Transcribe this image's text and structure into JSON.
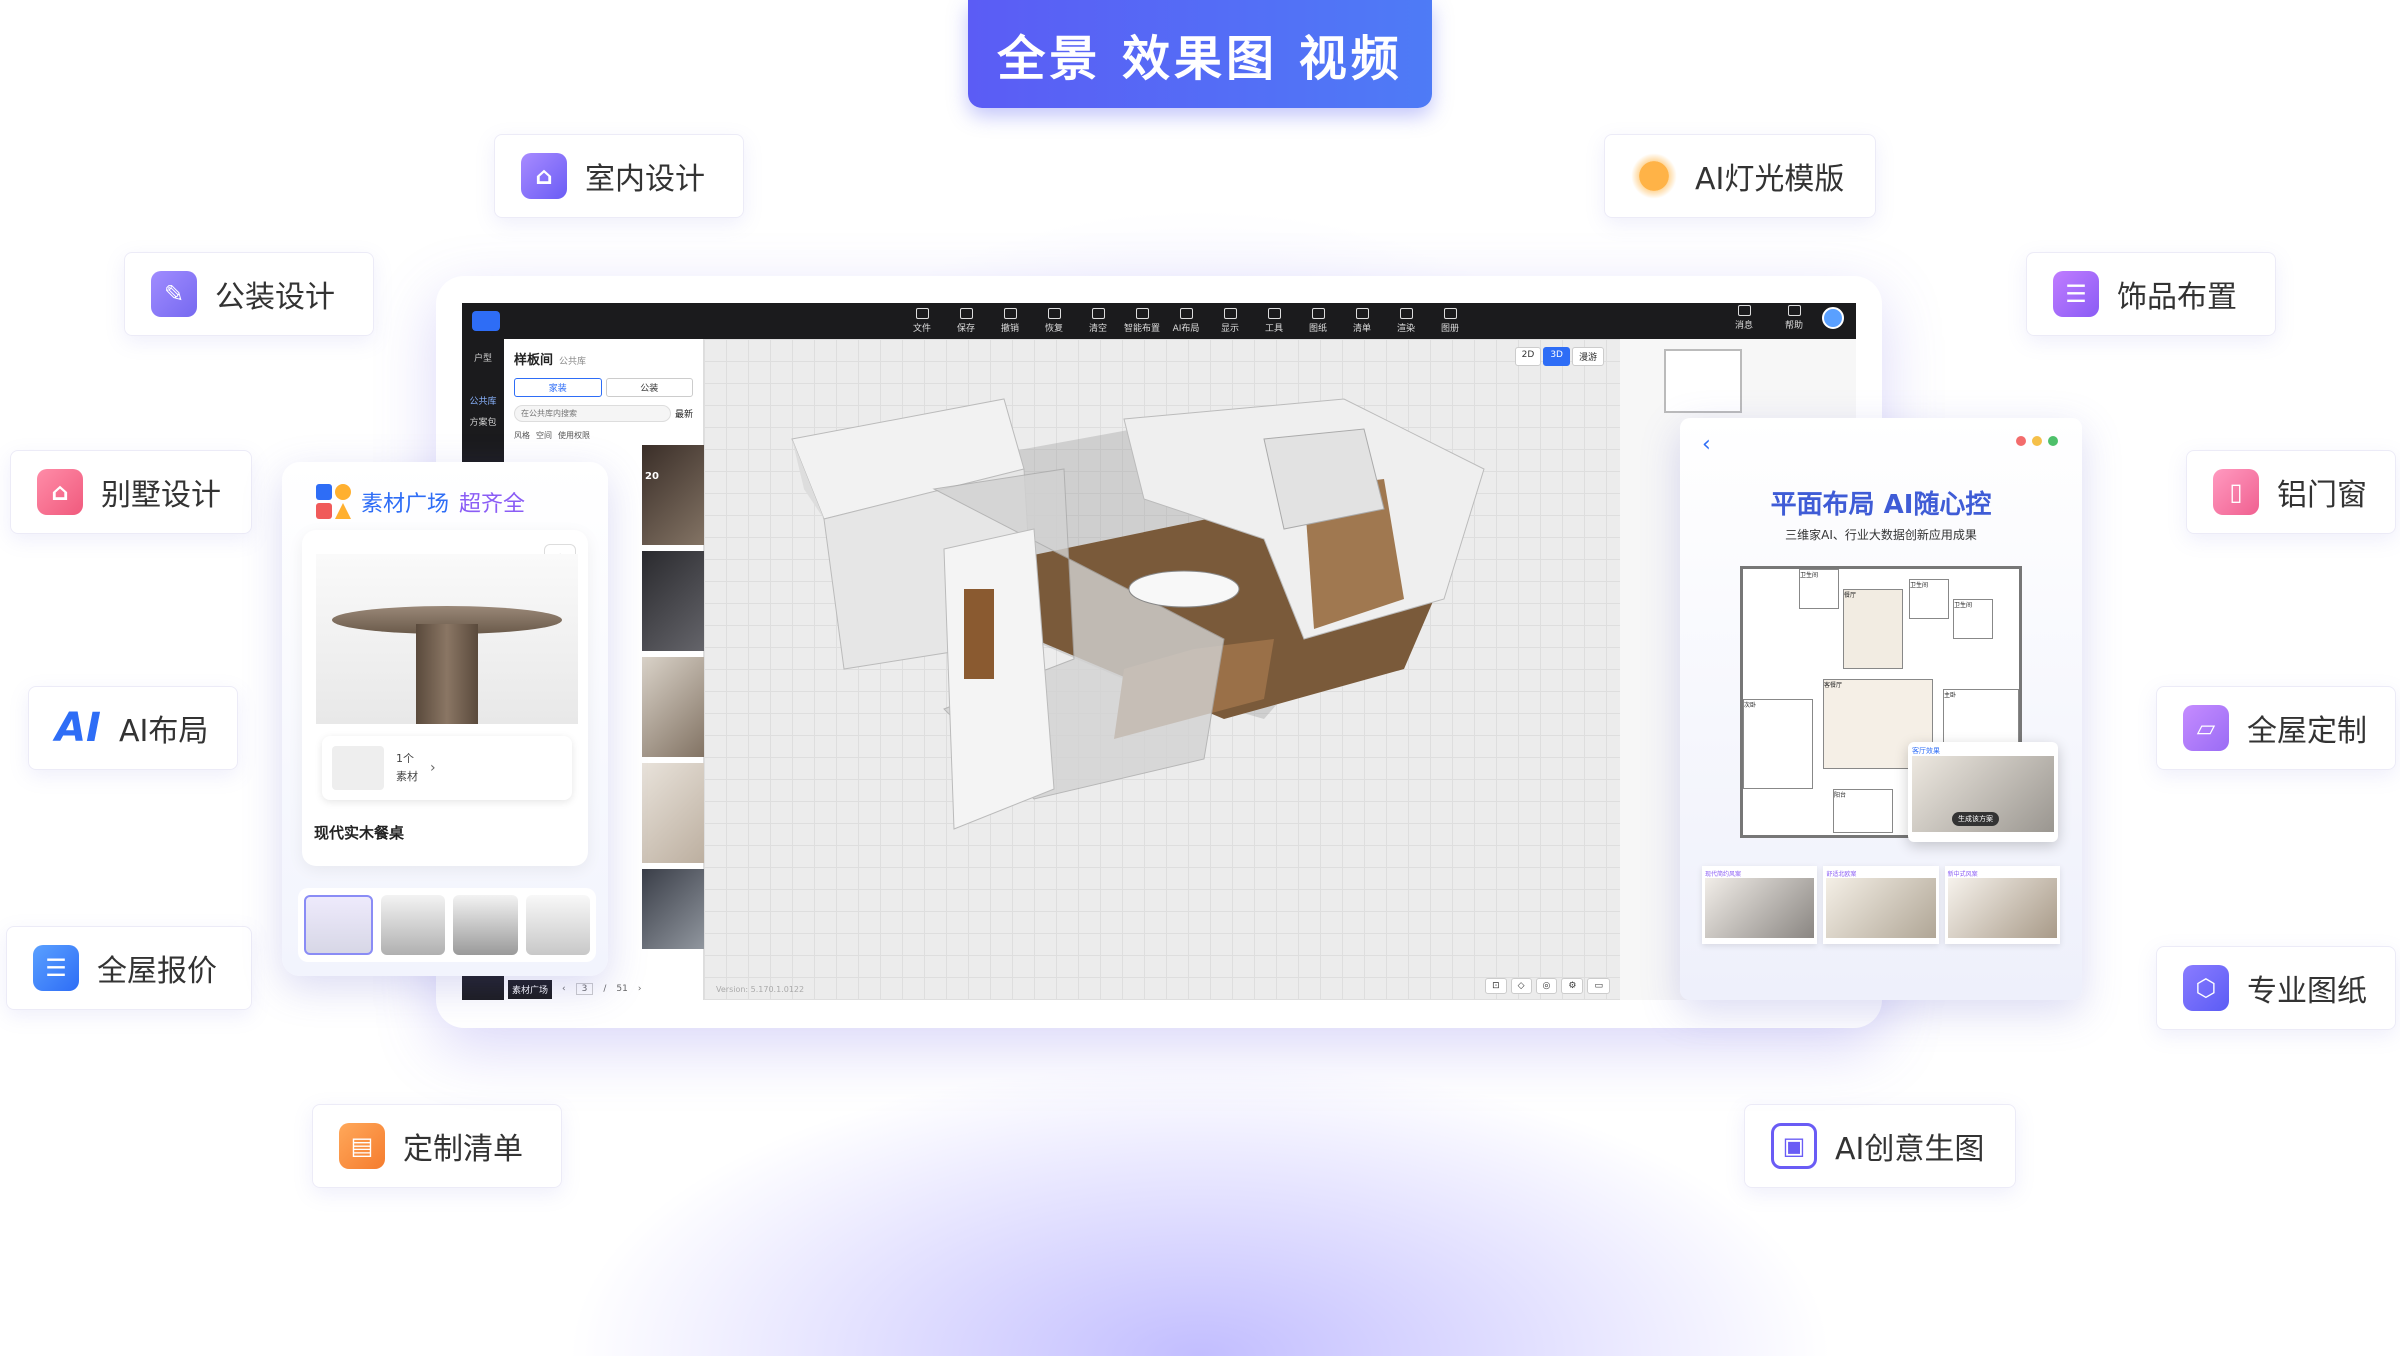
{
  "banner": {
    "title": "全景 效果图 视频"
  },
  "tags": {
    "interior": "室内设计",
    "lighting": "AI灯光模版",
    "public": "公装设计",
    "decor": "饰品布置",
    "villa": "别墅设计",
    "door": "铝门窗",
    "ai_layout": "AI布局",
    "custom": "全屋定制",
    "quote": "全屋报价",
    "drawing": "专业图纸",
    "list": "定制清单",
    "ai_image": "AI创意生图"
  },
  "toolbar": {
    "items": [
      "文件",
      "保存",
      "撤销",
      "恢复",
      "清空",
      "智能布置",
      "AI布局",
      "显示",
      "工具",
      "图纸",
      "清单",
      "渲染",
      "图册"
    ],
    "right": [
      "消息",
      "帮助"
    ]
  },
  "left_nav": [
    "户型",
    "公共库",
    "方案包"
  ],
  "panel": {
    "title": "样板间",
    "subtitle": "公共库",
    "tabs": [
      "家装",
      "公装"
    ],
    "search_placeholder": "在公共库内搜索",
    "sort": "最新",
    "filters": [
      "风格",
      "空间",
      "使用权限"
    ],
    "badge": "20",
    "page_current": "3",
    "page_total": "51",
    "bottom_tab": "素材广场"
  },
  "viewport": {
    "modes": [
      "2D",
      "3D",
      "漫游"
    ],
    "active_mode": "3D",
    "version": "Version: 5.170.1.0122"
  },
  "material_card": {
    "title_prefix": "素材广场",
    "title_suffix": "超齐全",
    "count": "1个",
    "count_label": "素材",
    "product_name": "现代实木餐桌"
  },
  "layout_card": {
    "title": "平面布局 AI随心控",
    "subtitle": "三维家AI、行业大数据创新应用成果",
    "rooms": [
      "卫生间",
      "餐厅",
      "卫生间",
      "卫生间",
      "次卧",
      "主卧",
      "客餐厅",
      "阳台"
    ],
    "thumb_labels": [
      "现代简约风案",
      "舒适北欧案",
      "新中式风案"
    ],
    "popup_label": "客厅效果",
    "popup_btn": "生成该方案"
  },
  "colors": {
    "accent": "#5b5cf5",
    "brand_blue": "#2e6df6",
    "toolbar_bg": "#1b1b1d"
  }
}
